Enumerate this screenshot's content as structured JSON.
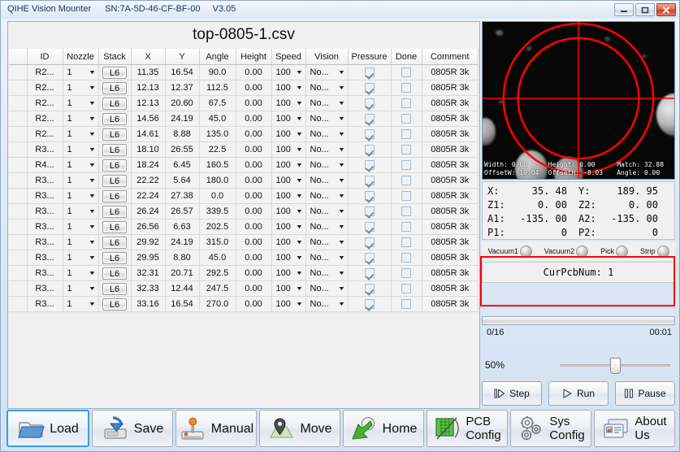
{
  "window": {
    "app_name": "QIHE Vision Mounter",
    "serial": "SN:7A-5D-46-CF-BF-00",
    "version": "V3.05",
    "minimize_label": "Minimize",
    "maximize_label": "Maximize",
    "close_label": "Close"
  },
  "file": {
    "title": "top-0805-1.csv"
  },
  "table": {
    "columns": [
      "ID",
      "Nozzle",
      "Stack",
      "X",
      "Y",
      "Angle",
      "Height",
      "Speed",
      "Vision",
      "Pressure",
      "Done",
      "Comment"
    ],
    "rows": [
      {
        "id": "R2...",
        "nozzle": "1",
        "stack": "L6",
        "x": "11.35",
        "y": "16.54",
        "angle": "90.0",
        "height": "0.00",
        "speed": "100",
        "vision": "No...",
        "pressure": true,
        "done": false,
        "comment": "0805R 3k"
      },
      {
        "id": "R2...",
        "nozzle": "1",
        "stack": "L6",
        "x": "12.13",
        "y": "12.37",
        "angle": "112.5",
        "height": "0.00",
        "speed": "100",
        "vision": "No...",
        "pressure": true,
        "done": false,
        "comment": "0805R 3k"
      },
      {
        "id": "R2...",
        "nozzle": "1",
        "stack": "L6",
        "x": "12.13",
        "y": "20.60",
        "angle": "67.5",
        "height": "0.00",
        "speed": "100",
        "vision": "No...",
        "pressure": true,
        "done": false,
        "comment": "0805R 3k"
      },
      {
        "id": "R2...",
        "nozzle": "1",
        "stack": "L6",
        "x": "14.56",
        "y": "24.19",
        "angle": "45.0",
        "height": "0.00",
        "speed": "100",
        "vision": "No...",
        "pressure": true,
        "done": false,
        "comment": "0805R 3k"
      },
      {
        "id": "R2...",
        "nozzle": "1",
        "stack": "L6",
        "x": "14.61",
        "y": "8.88",
        "angle": "135.0",
        "height": "0.00",
        "speed": "100",
        "vision": "No...",
        "pressure": true,
        "done": false,
        "comment": "0805R 3k"
      },
      {
        "id": "R3...",
        "nozzle": "1",
        "stack": "L6",
        "x": "18.10",
        "y": "26.55",
        "angle": "22.5",
        "height": "0.00",
        "speed": "100",
        "vision": "No...",
        "pressure": true,
        "done": false,
        "comment": "0805R 3k"
      },
      {
        "id": "R4...",
        "nozzle": "1",
        "stack": "L6",
        "x": "18.24",
        "y": "6.45",
        "angle": "160.5",
        "height": "0.00",
        "speed": "100",
        "vision": "No...",
        "pressure": true,
        "done": false,
        "comment": "0805R 3k"
      },
      {
        "id": "R3...",
        "nozzle": "1",
        "stack": "L6",
        "x": "22.22",
        "y": "5.64",
        "angle": "180.0",
        "height": "0.00",
        "speed": "100",
        "vision": "No...",
        "pressure": true,
        "done": false,
        "comment": "0805R 3k"
      },
      {
        "id": "R3...",
        "nozzle": "1",
        "stack": "L6",
        "x": "22.24",
        "y": "27.38",
        "angle": "0.0",
        "height": "0.00",
        "speed": "100",
        "vision": "No...",
        "pressure": true,
        "done": false,
        "comment": "0805R 3k"
      },
      {
        "id": "R3...",
        "nozzle": "1",
        "stack": "L6",
        "x": "26.24",
        "y": "26.57",
        "angle": "339.5",
        "height": "0.00",
        "speed": "100",
        "vision": "No...",
        "pressure": true,
        "done": false,
        "comment": "0805R 3k"
      },
      {
        "id": "R3...",
        "nozzle": "1",
        "stack": "L6",
        "x": "26.56",
        "y": "6.63",
        "angle": "202.5",
        "height": "0.00",
        "speed": "100",
        "vision": "No...",
        "pressure": true,
        "done": false,
        "comment": "0805R 3k"
      },
      {
        "id": "R3...",
        "nozzle": "1",
        "stack": "L6",
        "x": "29.92",
        "y": "24.19",
        "angle": "315.0",
        "height": "0.00",
        "speed": "100",
        "vision": "No...",
        "pressure": true,
        "done": false,
        "comment": "0805R 3k"
      },
      {
        "id": "R3...",
        "nozzle": "1",
        "stack": "L6",
        "x": "29.95",
        "y": "8.80",
        "angle": "45.0",
        "height": "0.00",
        "speed": "100",
        "vision": "No...",
        "pressure": true,
        "done": false,
        "comment": "0805R 3k"
      },
      {
        "id": "R3...",
        "nozzle": "1",
        "stack": "L6",
        "x": "32.31",
        "y": "20.71",
        "angle": "292.5",
        "height": "0.00",
        "speed": "100",
        "vision": "No...",
        "pressure": true,
        "done": false,
        "comment": "0805R 3k"
      },
      {
        "id": "R3...",
        "nozzle": "1",
        "stack": "L6",
        "x": "32.33",
        "y": "12.44",
        "angle": "247.5",
        "height": "0.00",
        "speed": "100",
        "vision": "No...",
        "pressure": true,
        "done": false,
        "comment": "0805R 3k"
      },
      {
        "id": "R3...",
        "nozzle": "1",
        "stack": "L6",
        "x": "33.16",
        "y": "16.54",
        "angle": "270.0",
        "height": "0.00",
        "speed": "100",
        "vision": "No...",
        "pressure": true,
        "done": false,
        "comment": "0805R 3k"
      }
    ]
  },
  "camera": {
    "stats": {
      "width_label": "Width:",
      "width_value": "0.00",
      "height_label": "Height:",
      "height_value": "0.00",
      "match_label": "Match:",
      "match_value": "32.88",
      "offsetw_label": "OffsetW:",
      "offsetw_value": "10.04",
      "offseth_label": "OffsetH:",
      "offseth_value": "-8.03",
      "angle_label": "Angle:",
      "angle_value": "0.00"
    },
    "reticle_color": "#ff0000"
  },
  "coords": [
    {
      "k1": "X:",
      "v1": "35. 48",
      "k2": "Y:",
      "v2": "189. 95"
    },
    {
      "k1": "Z1:",
      "v1": "0. 00",
      "k2": "Z2:",
      "v2": "0. 00"
    },
    {
      "k1": "A1:",
      "v1": "-135. 00",
      "k2": "A2:",
      "v2": "-135. 00"
    },
    {
      "k1": "P1:",
      "v1": "0",
      "k2": "P2:",
      "v2": "0"
    }
  ],
  "lamps": [
    {
      "label": "Vacuum1",
      "on": false
    },
    {
      "label": "Vacuum2",
      "on": false
    },
    {
      "label": "Pick",
      "on": false
    },
    {
      "label": "Strip",
      "on": false
    }
  ],
  "pcb": {
    "current_label": "CurPcbNum: 1",
    "highlight_color": "#ff0000"
  },
  "progress": {
    "percent": 0,
    "count_label": "0/16",
    "time_label": "00:01"
  },
  "speed_slider": {
    "percent_label": "50%",
    "value": 50
  },
  "run_controls": [
    {
      "label": "Step",
      "icon": "step-icon"
    },
    {
      "label": "Run",
      "icon": "play-icon"
    },
    {
      "label": "Pause",
      "icon": "pause-icon"
    }
  ],
  "toolbar": [
    {
      "label": "Load",
      "icon": "folder-icon",
      "selected": true
    },
    {
      "label": "Save",
      "icon": "save-disk-icon",
      "selected": false
    },
    {
      "label": "Manual",
      "icon": "joystick-icon",
      "selected": false
    },
    {
      "label": "Move",
      "icon": "map-pin-icon",
      "selected": false
    },
    {
      "label": "Home",
      "icon": "home-arrow-icon",
      "selected": false
    },
    {
      "label": "PCB Config",
      "line1": "PCB",
      "line2": "Config",
      "icon": "pcb-icon",
      "selected": false
    },
    {
      "label": "Sys Config",
      "line1": "Sys",
      "line2": "Config",
      "icon": "gears-icon",
      "selected": false
    },
    {
      "label": "About Us",
      "line1": "About",
      "line2": "Us",
      "icon": "cards-icon",
      "selected": false
    }
  ]
}
